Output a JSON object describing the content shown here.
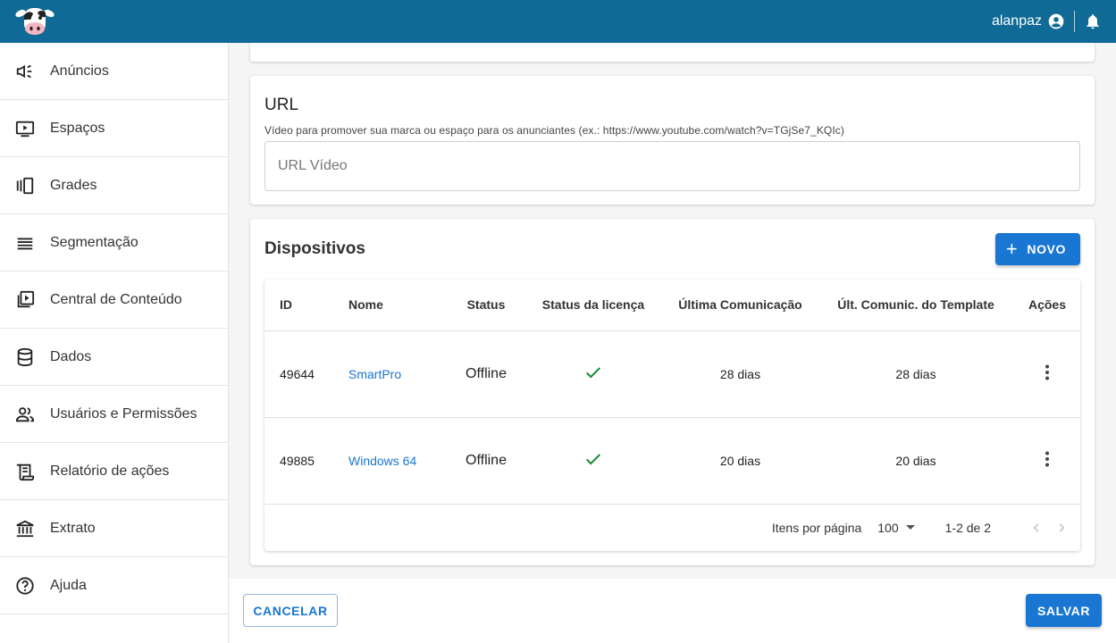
{
  "header": {
    "username": "alanpaz",
    "colors": {
      "bar": "#0f6a96",
      "accent": "#1976d2"
    }
  },
  "sidebar": {
    "items": [
      {
        "label": "Anúncios",
        "icon": "megaphone-icon"
      },
      {
        "label": "Espaços",
        "icon": "screen-play-icon"
      },
      {
        "label": "Grades",
        "icon": "carousel-icon"
      },
      {
        "label": "Segmentação",
        "icon": "list-lines-icon"
      },
      {
        "label": "Central de Conteúdo",
        "icon": "video-library-icon"
      },
      {
        "label": "Dados",
        "icon": "database-icon"
      },
      {
        "label": "Usuários e Permissões",
        "icon": "people-icon"
      },
      {
        "label": "Relatório de ações",
        "icon": "receipt-icon"
      },
      {
        "label": "Extrato",
        "icon": "bank-icon"
      },
      {
        "label": "Ajuda",
        "icon": "help-circle-icon"
      }
    ]
  },
  "url_section": {
    "title": "URL",
    "hint": "Vídeo para promover sua marca ou espaço para os anunciantes (ex.: https://www.youtube.com/watch?v=TGjSe7_KQIc)",
    "input_placeholder": "URL Vídeo",
    "input_value": ""
  },
  "devices": {
    "title": "Dispositivos",
    "new_button": "NOVO",
    "columns": [
      "ID",
      "Nome",
      "Status",
      "Status da licença",
      "Última Comunicação",
      "Últ. Comunic. do Template",
      "Ações"
    ],
    "rows": [
      {
        "id": "49644",
        "name": "SmartPro",
        "status": "Offline",
        "license_ok": true,
        "last_comm": "28 dias",
        "template_comm": "28 dias"
      },
      {
        "id": "49885",
        "name": "Windows 64",
        "status": "Offline",
        "license_ok": true,
        "last_comm": "20 dias",
        "template_comm": "20 dias"
      }
    ],
    "pagination": {
      "items_per_page_label": "Itens por página",
      "items_per_page": "100",
      "range": "1-2 de 2"
    }
  },
  "footer": {
    "cancel": "CANCELAR",
    "save": "SALVAR"
  }
}
